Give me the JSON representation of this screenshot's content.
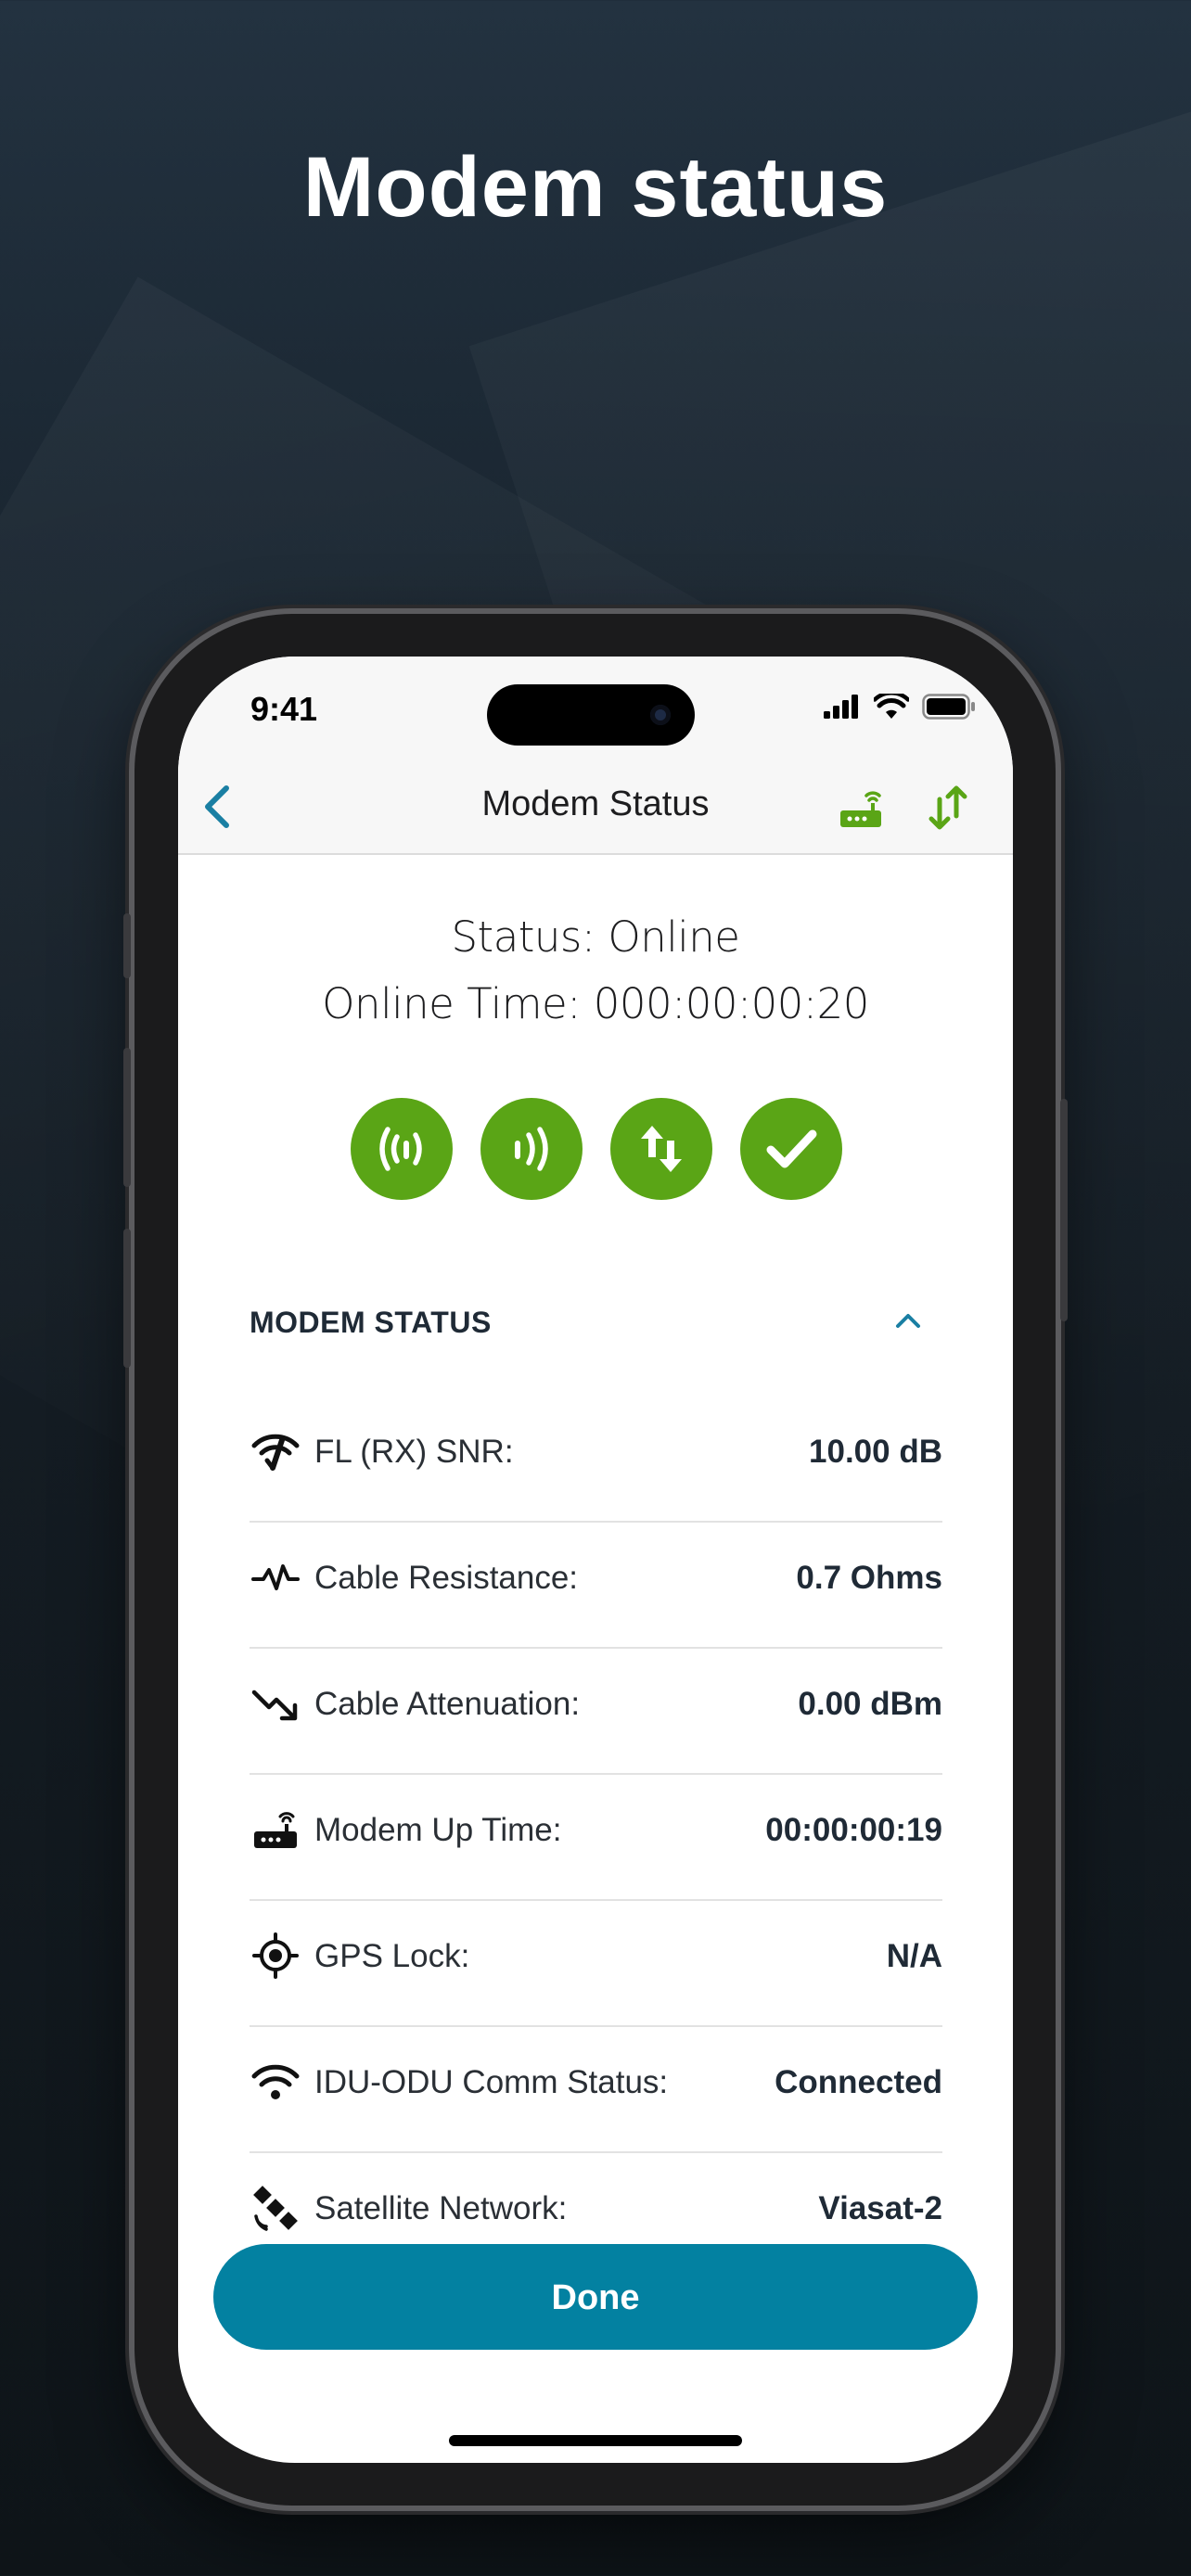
{
  "headline": "Modem status",
  "statusbar": {
    "time": "9:41"
  },
  "navbar": {
    "title": "Modem Status",
    "back_icon": "chevron-left-icon",
    "icon1": "modem-icon",
    "icon2": "up-down-arrows-icon"
  },
  "summary": {
    "status": "Status: Online",
    "online_time": "Online Time: 000:00:00:20"
  },
  "indicators": [
    "rx-signal-icon",
    "tx-signal-icon",
    "transfer-icon",
    "check-icon"
  ],
  "section": {
    "title": "MODEM STATUS",
    "collapse_icon": "chevron-up-icon"
  },
  "rows": [
    {
      "icon": "snr-wifi-icon",
      "label": "FL (RX) SNR:",
      "value": "10.00 dB"
    },
    {
      "icon": "pulse-icon",
      "label": "Cable Resistance:",
      "value": "0.7 Ohms"
    },
    {
      "icon": "trend-down-icon",
      "label": "Cable Attenuation:",
      "value": "0.00 dBm"
    },
    {
      "icon": "modem-icon",
      "label": "Modem Up Time:",
      "value": "00:00:00:19"
    },
    {
      "icon": "gps-target-icon",
      "label": "GPS Lock:",
      "value": "N/A"
    },
    {
      "icon": "wifi-icon",
      "label": "IDU-ODU Comm Status:",
      "value": "Connected"
    },
    {
      "icon": "satellite-icon",
      "label": "Satellite Network:",
      "value": "Viasat-2"
    }
  ],
  "done_button": "Done",
  "colors": {
    "accent_green": "#5aa516",
    "button_teal": "#0381a1",
    "nav_teal": "#1a7fa3"
  }
}
